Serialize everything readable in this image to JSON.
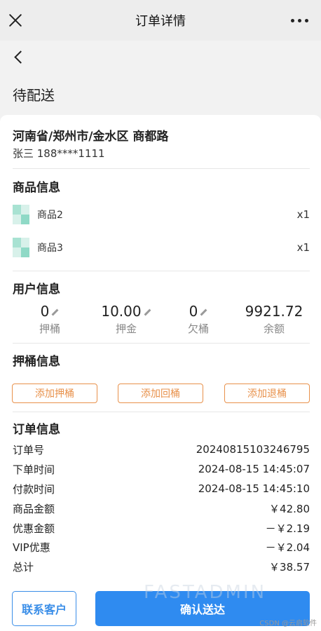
{
  "topbar": {
    "title": "订单详情",
    "close_icon": "close-icon",
    "more_icon": "more-dots-icon"
  },
  "order_status": "待配送",
  "address": {
    "line": "河南省/郑州市/金水区 商都路",
    "contact": "张三 188****1111"
  },
  "goods": {
    "title": "商品信息",
    "items": [
      {
        "name": "商品2",
        "qty": "x1"
      },
      {
        "name": "商品3",
        "qty": "x1"
      }
    ]
  },
  "user_info": {
    "title": "用户信息",
    "stats": [
      {
        "value": "0",
        "label": "押桶",
        "editable": true
      },
      {
        "value": "10.00",
        "label": "押金",
        "editable": true
      },
      {
        "value": "0",
        "label": "欠桶",
        "editable": true
      },
      {
        "value": "9921.72",
        "label": "余额",
        "editable": false
      }
    ]
  },
  "bucket_info": {
    "title": "押桶信息",
    "buttons": [
      "添加押桶",
      "添加回桶",
      "添加退桶"
    ]
  },
  "order_info": {
    "title": "订单信息",
    "rows": [
      {
        "key": "订单号",
        "value": "20240815103246795"
      },
      {
        "key": "下单时间",
        "value": "2024-08-15 14:45:07"
      },
      {
        "key": "付款时间",
        "value": "2024-08-15 14:45:10"
      },
      {
        "key": "商品金额",
        "value": "￥42.80"
      },
      {
        "key": "优惠金额",
        "value": "－￥2.19"
      },
      {
        "key": "VIP优惠",
        "value": "－￥2.04"
      },
      {
        "key": "总计",
        "value": "￥38.57"
      }
    ]
  },
  "actions": {
    "contact_label": "联系客户",
    "confirm_label": "确认送达"
  },
  "watermark": "FASTADMIN",
  "footer": "CSDN @云启软件",
  "colors": {
    "accent_blue": "#2f8bf0",
    "accent_orange": "#e8914b"
  }
}
